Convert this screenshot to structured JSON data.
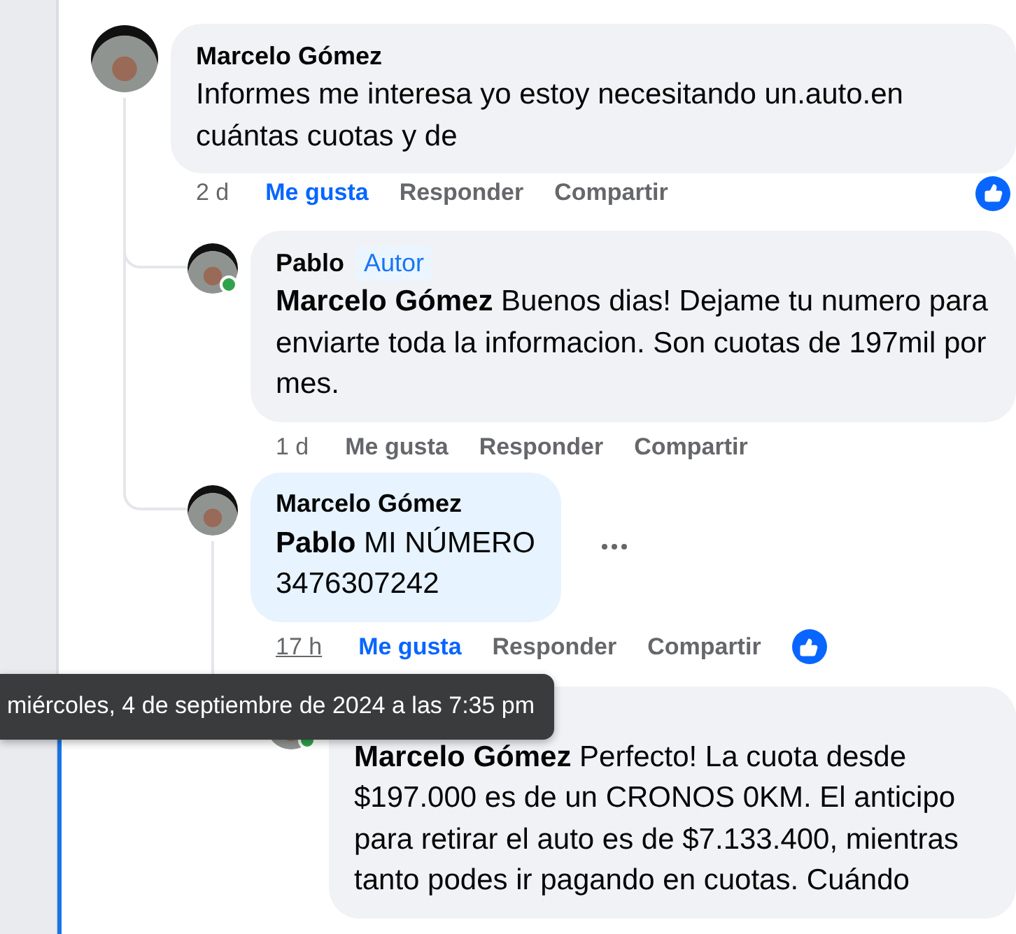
{
  "comments": [
    {
      "author": "Marcelo Gómez",
      "text": "Informes me interesa yo estoy necesitando un.auto.en cuántas cuotas y de",
      "time": "2 d",
      "time_hovered": false,
      "like_label": "Me gusta",
      "liked": true,
      "reply_label": "Responder",
      "share_label": "Compartir",
      "reacted": true,
      "children": [
        {
          "author": "Pablo",
          "badge": "Autor",
          "online": true,
          "mention": "Marcelo Gómez",
          "text": "Buenos dias! Dejame tu numero para enviarte toda la informacion. Son cuotas de 197mil por mes.",
          "time": "1 d",
          "time_hovered": false,
          "like_label": "Me gusta",
          "liked": false,
          "reply_label": "Responder",
          "share_label": "Compartir"
        },
        {
          "author": "Marcelo Gómez",
          "highlighted": true,
          "mention": "Pablo",
          "text": "MI NÚMERO\n3476307242",
          "time": "17 h",
          "time_hovered": true,
          "like_label": "Me gusta",
          "liked": true,
          "reply_label": "Responder",
          "share_label": "Compartir",
          "reacted": true,
          "more_menu": true,
          "children": [
            {
              "online": true,
              "mention": "Marcelo Gómez",
              "text": "Perfecto! La cuota desde $197.000 es de un CRONOS 0KM. El anticipo para retirar el auto es de $7.133.400, mientras tanto podes ir pagando en cuotas. Cuándo"
            }
          ]
        }
      ]
    }
  ],
  "tooltip": {
    "text": "miércoles, 4 de septiembre de 2024 a las 7:35 pm"
  }
}
